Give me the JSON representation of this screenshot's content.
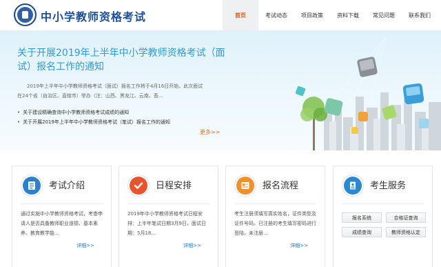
{
  "header": {
    "site_title": "中小学教师资格考试",
    "nav": [
      "首页",
      "考试动态",
      "项目政策",
      "资料下载",
      "常见问题",
      "联系我们"
    ],
    "active_index": 0
  },
  "banner": {
    "title": "关于开展2019年上半年中小学教师资格考试（面试）报名工作的通知",
    "description": "2019年上半年中小学教师资格考试（面试）报名工作将于4月16日开始，此次面试在24个省（自治区、直辖市）举办（注：山西、黑龙江、云南、吾...",
    "links": [
      "关于建设精确查询中小学教师资格考试成绩的通知",
      "关于开展2019年上半年中小学教师资格考试（笔试）报名工作的通知"
    ],
    "more_label": "更多>>"
  },
  "cards": [
    {
      "title": "考试介绍",
      "icon": "document-icon",
      "icon_color": "#2d7fd0",
      "text": "通过实施中小学教师资格考试，考查申请人是否具备教师职业道德、基本素养、教育教学能...",
      "more_label": "详细>>"
    },
    {
      "title": "日程安排",
      "icon": "checkmark-icon",
      "icon_color": "#e8542c",
      "text": "2019年中小学教师资格考试日程安排：上半年笔试日期3月9日，面试日期：5月18...",
      "more_label": "详细>>"
    },
    {
      "title": "报名流程",
      "icon": "form-icon",
      "icon_color": "#f0902a",
      "text": "考生注册须填写真实姓名，证件类型及证件号码。已注册的考生填写密码进行登陆，未注册...",
      "more_label": "详细>>"
    },
    {
      "title": "考生服务",
      "icon": "id-card-icon",
      "icon_color": "#2a8ad0",
      "buttons": [
        "报名系统",
        "合格证查询",
        "成绩查询",
        "教师资格认定"
      ]
    }
  ]
}
